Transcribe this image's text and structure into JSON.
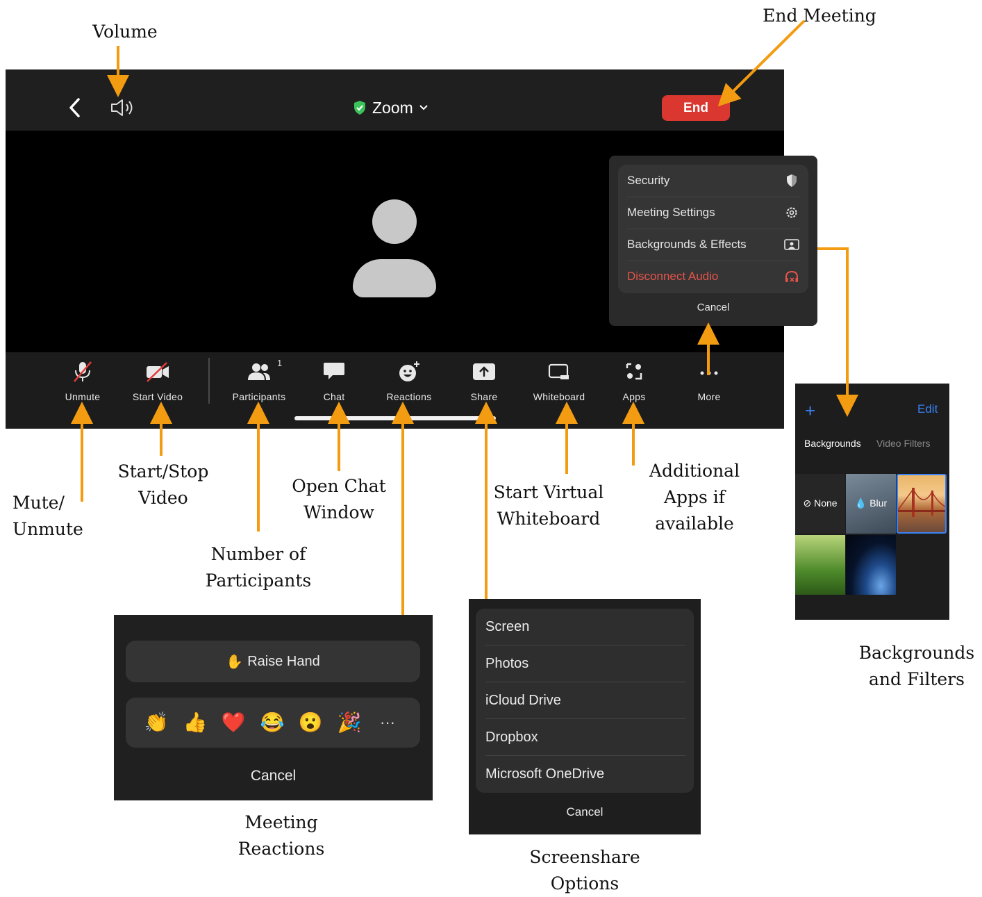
{
  "callouts": {
    "volume": "Volume",
    "end_meeting": "End Meeting",
    "mute": [
      "Mute/",
      "Unmute"
    ],
    "video": [
      "Start/Stop",
      "Video"
    ],
    "participants": [
      "Number of",
      "Participants"
    ],
    "chat": [
      "Open Chat",
      "Window"
    ],
    "whiteboard": [
      "Start Virtual",
      "Whiteboard"
    ],
    "apps": [
      "Additional",
      "Apps if",
      "available"
    ],
    "backgrounds": [
      "Backgrounds",
      "and Filters"
    ],
    "reactions": [
      "Meeting",
      "Reactions"
    ],
    "screenshare": [
      "Screenshare",
      "Options"
    ]
  },
  "header": {
    "title": "Zoom",
    "end_label": "End"
  },
  "toolbar": {
    "items": [
      {
        "label": "Unmute",
        "icon": "mic-muted-icon"
      },
      {
        "label": "Start Video",
        "icon": "video-off-icon"
      },
      {
        "label": "Participants",
        "icon": "participants-icon"
      },
      {
        "label": "Chat",
        "icon": "chat-icon"
      },
      {
        "label": "Reactions",
        "icon": "reaction-icon"
      },
      {
        "label": "Share",
        "icon": "share-icon"
      },
      {
        "label": "Whiteboard",
        "icon": "whiteboard-icon"
      },
      {
        "label": "Apps",
        "icon": "apps-icon"
      },
      {
        "label": "More",
        "icon": "more-icon"
      }
    ],
    "participants_count": "1"
  },
  "more_menu": {
    "items": [
      {
        "label": "Security",
        "icon": "shield-icon",
        "color": "#e6e6e6"
      },
      {
        "label": "Meeting Settings",
        "icon": "gear-icon",
        "color": "#e6e6e6"
      },
      {
        "label": "Backgrounds & Effects",
        "icon": "portrait-icon",
        "color": "#e6e6e6"
      },
      {
        "label": "Disconnect Audio",
        "icon": "headset-off-icon",
        "color": "#e5534b"
      }
    ],
    "cancel": "Cancel"
  },
  "backgrounds_panel": {
    "add": "+",
    "edit": "Edit",
    "tabs": [
      "Backgrounds",
      "Video Filters"
    ],
    "tiles": [
      "None",
      "Blur"
    ]
  },
  "reactions_panel": {
    "raise_hand": "Raise Hand",
    "emojis": [
      "👏",
      "👍",
      "❤️",
      "😂",
      "😮",
      "🎉",
      "···"
    ],
    "cancel": "Cancel"
  },
  "share_panel": {
    "items": [
      "Screen",
      "Photos",
      "iCloud Drive",
      "Dropbox",
      "Microsoft OneDrive"
    ],
    "cancel": "Cancel"
  },
  "colors": {
    "arrow": "#f39c12",
    "end_button": "#d9372f",
    "accent_blue": "#3a82f7",
    "shield_green": "#3cc25a"
  }
}
